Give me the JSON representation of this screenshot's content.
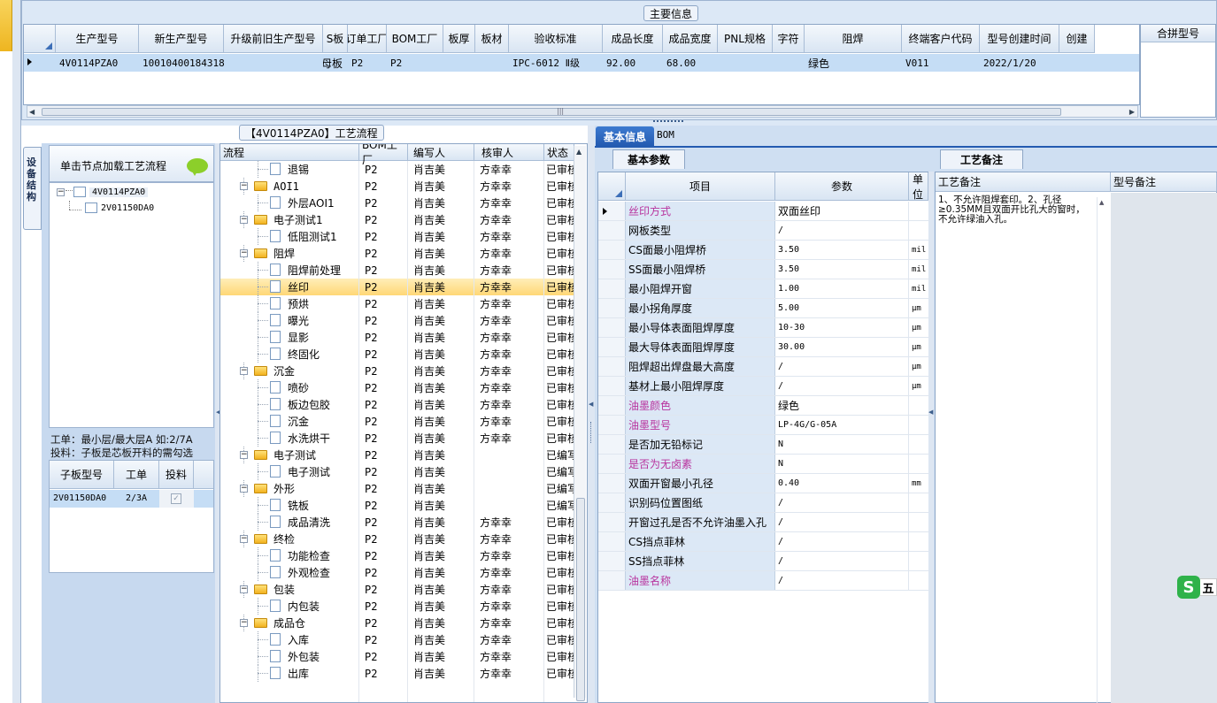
{
  "top": {
    "title": "主要信息",
    "columns": [
      "生产型号",
      "新生产型号",
      "升级前旧生产型号",
      "S板",
      "订单工厂",
      "BOM工厂",
      "板厚",
      "板材",
      "验收标准",
      "成品长度",
      "成品宽度",
      "PNL规格",
      "字符",
      "阻焊",
      "终端客户代码",
      "型号创建时间",
      "创建"
    ],
    "row": [
      "4V0114PZA0",
      "10010400184318",
      "",
      "母板",
      "P2",
      "P2",
      "",
      "",
      "IPC-6012 Ⅱ级",
      "92.00",
      "68.00",
      "",
      "",
      "绿色",
      "V011",
      "2022/1/20",
      ""
    ],
    "merge_header": "合拼型号"
  },
  "left": {
    "vtab": "设备结构",
    "load_button": "单击节点加载工艺流程",
    "tree_root": "4V0114PZA0",
    "tree_child": "2V01150DA0",
    "note_line1": "工单：最小层/最大层A 如:2/7A",
    "note_line2": "投料：子板是芯板开料的需勾选",
    "sub_headers": [
      "子板型号",
      "工单",
      "投料"
    ],
    "sub_row": {
      "model": "2V01150DA0",
      "order": "2/3A",
      "feed_checked": true
    }
  },
  "process": {
    "title": "【4V0114PZA0】工艺流程",
    "headers": [
      "流程",
      "BOM工厂",
      "编写人",
      "核审人",
      "状态"
    ],
    "rows": [
      {
        "indent": 2,
        "type": "doc",
        "name": "退锡",
        "f": "P2",
        "w": "肖吉美",
        "r": "方幸幸",
        "s": "已审核"
      },
      {
        "indent": 1,
        "type": "folder",
        "name": "AOI1",
        "f": "P2",
        "w": "肖吉美",
        "r": "方幸幸",
        "s": "已审核"
      },
      {
        "indent": 2,
        "type": "doc",
        "name": "外层AOI1",
        "f": "P2",
        "w": "肖吉美",
        "r": "方幸幸",
        "s": "已审核"
      },
      {
        "indent": 1,
        "type": "folder",
        "name": "电子测试1",
        "f": "P2",
        "w": "肖吉美",
        "r": "方幸幸",
        "s": "已审核"
      },
      {
        "indent": 2,
        "type": "doc",
        "name": "低阻测试1",
        "f": "P2",
        "w": "肖吉美",
        "r": "方幸幸",
        "s": "已审核"
      },
      {
        "indent": 1,
        "type": "folder",
        "name": "阻焊",
        "f": "P2",
        "w": "肖吉美",
        "r": "方幸幸",
        "s": "已审核"
      },
      {
        "indent": 2,
        "type": "doc",
        "name": "阻焊前处理",
        "f": "P2",
        "w": "肖吉美",
        "r": "方幸幸",
        "s": "已审核"
      },
      {
        "indent": 2,
        "type": "doc",
        "name": "丝印",
        "f": "P2",
        "w": "肖吉美",
        "r": "方幸幸",
        "s": "已审核",
        "sel": true
      },
      {
        "indent": 2,
        "type": "doc",
        "name": "预烘",
        "f": "P2",
        "w": "肖吉美",
        "r": "方幸幸",
        "s": "已审核"
      },
      {
        "indent": 2,
        "type": "doc",
        "name": "曝光",
        "f": "P2",
        "w": "肖吉美",
        "r": "方幸幸",
        "s": "已审核"
      },
      {
        "indent": 2,
        "type": "doc",
        "name": "显影",
        "f": "P2",
        "w": "肖吉美",
        "r": "方幸幸",
        "s": "已审核"
      },
      {
        "indent": 2,
        "type": "doc",
        "name": "终固化",
        "f": "P2",
        "w": "肖吉美",
        "r": "方幸幸",
        "s": "已审核"
      },
      {
        "indent": 1,
        "type": "folder",
        "name": "沉金",
        "f": "P2",
        "w": "肖吉美",
        "r": "方幸幸",
        "s": "已审核"
      },
      {
        "indent": 2,
        "type": "doc",
        "name": "喷砂",
        "f": "P2",
        "w": "肖吉美",
        "r": "方幸幸",
        "s": "已审核"
      },
      {
        "indent": 2,
        "type": "doc",
        "name": "板边包胶",
        "f": "P2",
        "w": "肖吉美",
        "r": "方幸幸",
        "s": "已审核"
      },
      {
        "indent": 2,
        "type": "doc",
        "name": "沉金",
        "f": "P2",
        "w": "肖吉美",
        "r": "方幸幸",
        "s": "已审核"
      },
      {
        "indent": 2,
        "type": "doc",
        "name": "水洗烘干",
        "f": "P2",
        "w": "肖吉美",
        "r": "方幸幸",
        "s": "已审核"
      },
      {
        "indent": 1,
        "type": "folder",
        "name": "电子测试",
        "f": "P2",
        "w": "肖吉美",
        "r": "",
        "s": "已编写"
      },
      {
        "indent": 2,
        "type": "doc",
        "name": "电子测试",
        "f": "P2",
        "w": "肖吉美",
        "r": "",
        "s": "已编写"
      },
      {
        "indent": 1,
        "type": "folder",
        "name": "外形",
        "f": "P2",
        "w": "肖吉美",
        "r": "",
        "s": "已编写"
      },
      {
        "indent": 2,
        "type": "doc",
        "name": "铣板",
        "f": "P2",
        "w": "肖吉美",
        "r": "",
        "s": "已编写"
      },
      {
        "indent": 2,
        "type": "doc",
        "name": "成品清洗",
        "f": "P2",
        "w": "肖吉美",
        "r": "方幸幸",
        "s": "已审核"
      },
      {
        "indent": 1,
        "type": "folder",
        "name": "终检",
        "f": "P2",
        "w": "肖吉美",
        "r": "方幸幸",
        "s": "已审核"
      },
      {
        "indent": 2,
        "type": "doc",
        "name": "功能检查",
        "f": "P2",
        "w": "肖吉美",
        "r": "方幸幸",
        "s": "已审核"
      },
      {
        "indent": 2,
        "type": "doc",
        "name": "外观检查",
        "f": "P2",
        "w": "肖吉美",
        "r": "方幸幸",
        "s": "已审核"
      },
      {
        "indent": 1,
        "type": "folder",
        "name": "包装",
        "f": "P2",
        "w": "肖吉美",
        "r": "方幸幸",
        "s": "已审核"
      },
      {
        "indent": 2,
        "type": "doc",
        "name": "内包装",
        "f": "P2",
        "w": "肖吉美",
        "r": "方幸幸",
        "s": "已审核"
      },
      {
        "indent": 1,
        "type": "folder",
        "name": "成品仓",
        "f": "P2",
        "w": "肖吉美",
        "r": "方幸幸",
        "s": "已审核"
      },
      {
        "indent": 2,
        "type": "doc",
        "name": "入库",
        "f": "P2",
        "w": "肖吉美",
        "r": "方幸幸",
        "s": "已审核"
      },
      {
        "indent": 2,
        "type": "doc",
        "name": "外包装",
        "f": "P2",
        "w": "肖吉美",
        "r": "方幸幸",
        "s": "已审核"
      },
      {
        "indent": 2,
        "type": "doc",
        "name": "出库",
        "f": "P2",
        "w": "肖吉美",
        "r": "方幸幸",
        "s": "已审核"
      }
    ]
  },
  "right": {
    "tab_basic": "基本信息",
    "tab_bom": "BOM",
    "sub_tab_params": "基本参数",
    "param_headers": [
      "项目",
      "参数",
      "单位"
    ],
    "params": [
      {
        "k": "丝印方式",
        "v": "双面丝印",
        "u": "",
        "pink": true,
        "sel": true
      },
      {
        "k": "网板类型",
        "v": "/",
        "u": ""
      },
      {
        "k": "CS面最小阻焊桥",
        "v": "3.50",
        "u": "mil"
      },
      {
        "k": "SS面最小阻焊桥",
        "v": "3.50",
        "u": "mil"
      },
      {
        "k": "最小阻焊开窗",
        "v": "1.00",
        "u": "mil"
      },
      {
        "k": "最小拐角厚度",
        "v": "5.00",
        "u": "μm"
      },
      {
        "k": "最小导体表面阻焊厚度",
        "v": "10-30",
        "u": "μm"
      },
      {
        "k": "最大导体表面阻焊厚度",
        "v": "30.00",
        "u": "μm"
      },
      {
        "k": "阻焊超出焊盘最大高度",
        "v": "/",
        "u": "μm"
      },
      {
        "k": "基材上最小阻焊厚度",
        "v": "/",
        "u": "μm"
      },
      {
        "k": "油墨颜色",
        "v": "绿色",
        "u": "",
        "pink": true
      },
      {
        "k": "油墨型号",
        "v": "LP-4G/G-05A",
        "u": "",
        "pink": true
      },
      {
        "k": "是否加无铅标记",
        "v": "N",
        "u": ""
      },
      {
        "k": "是否为无卤素",
        "v": "N",
        "u": "",
        "pink": true
      },
      {
        "k": "双面开窗最小孔径",
        "v": "0.40",
        "u": "mm"
      },
      {
        "k": "识别码位置图纸",
        "v": "/",
        "u": ""
      },
      {
        "k": "开窗过孔是否不允许油墨入孔",
        "v": "/",
        "u": ""
      },
      {
        "k": "CS挡点菲林",
        "v": "/",
        "u": ""
      },
      {
        "k": "SS挡点菲林",
        "v": "/",
        "u": ""
      },
      {
        "k": "油墨名称",
        "v": "/",
        "u": "",
        "pink": true
      }
    ],
    "sub_tab_remark": "工艺备注",
    "remark_headers": [
      "工艺备注",
      "型号备注"
    ],
    "remark_text": "1、不允许阻焊套印。2、孔径≥0.35MM且双面开比孔大的窗时，不允许绿油入孔。"
  }
}
